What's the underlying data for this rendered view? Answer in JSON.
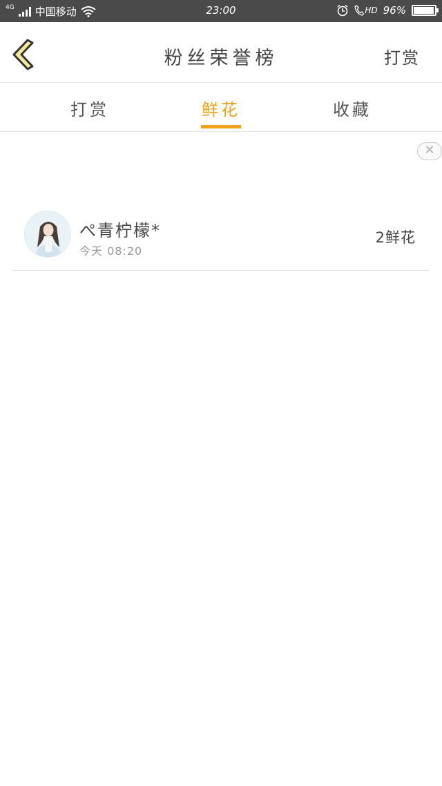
{
  "status_bar": {
    "network": "4G",
    "carrier": "中国移动",
    "time": "23:00",
    "hd": "HD",
    "battery": "96%",
    "battery_level": 0.96
  },
  "header": {
    "title": "粉丝荣誉榜",
    "action": "打赏",
    "back_icon": "chevron-left-icon"
  },
  "tabs": [
    {
      "label": "打赏",
      "active": false
    },
    {
      "label": "鲜花",
      "active": true
    },
    {
      "label": "收藏",
      "active": false
    }
  ],
  "close_icon": "close-icon",
  "list": [
    {
      "name": "ぺ青柠檬*",
      "time": "今天 08:20",
      "amount": "2鲜花"
    }
  ],
  "colors": {
    "accent": "#f0a21a",
    "status_bar": "#4a4a4a",
    "back_icon_fill": "#f5e99a",
    "back_icon_stroke": "#333333"
  }
}
